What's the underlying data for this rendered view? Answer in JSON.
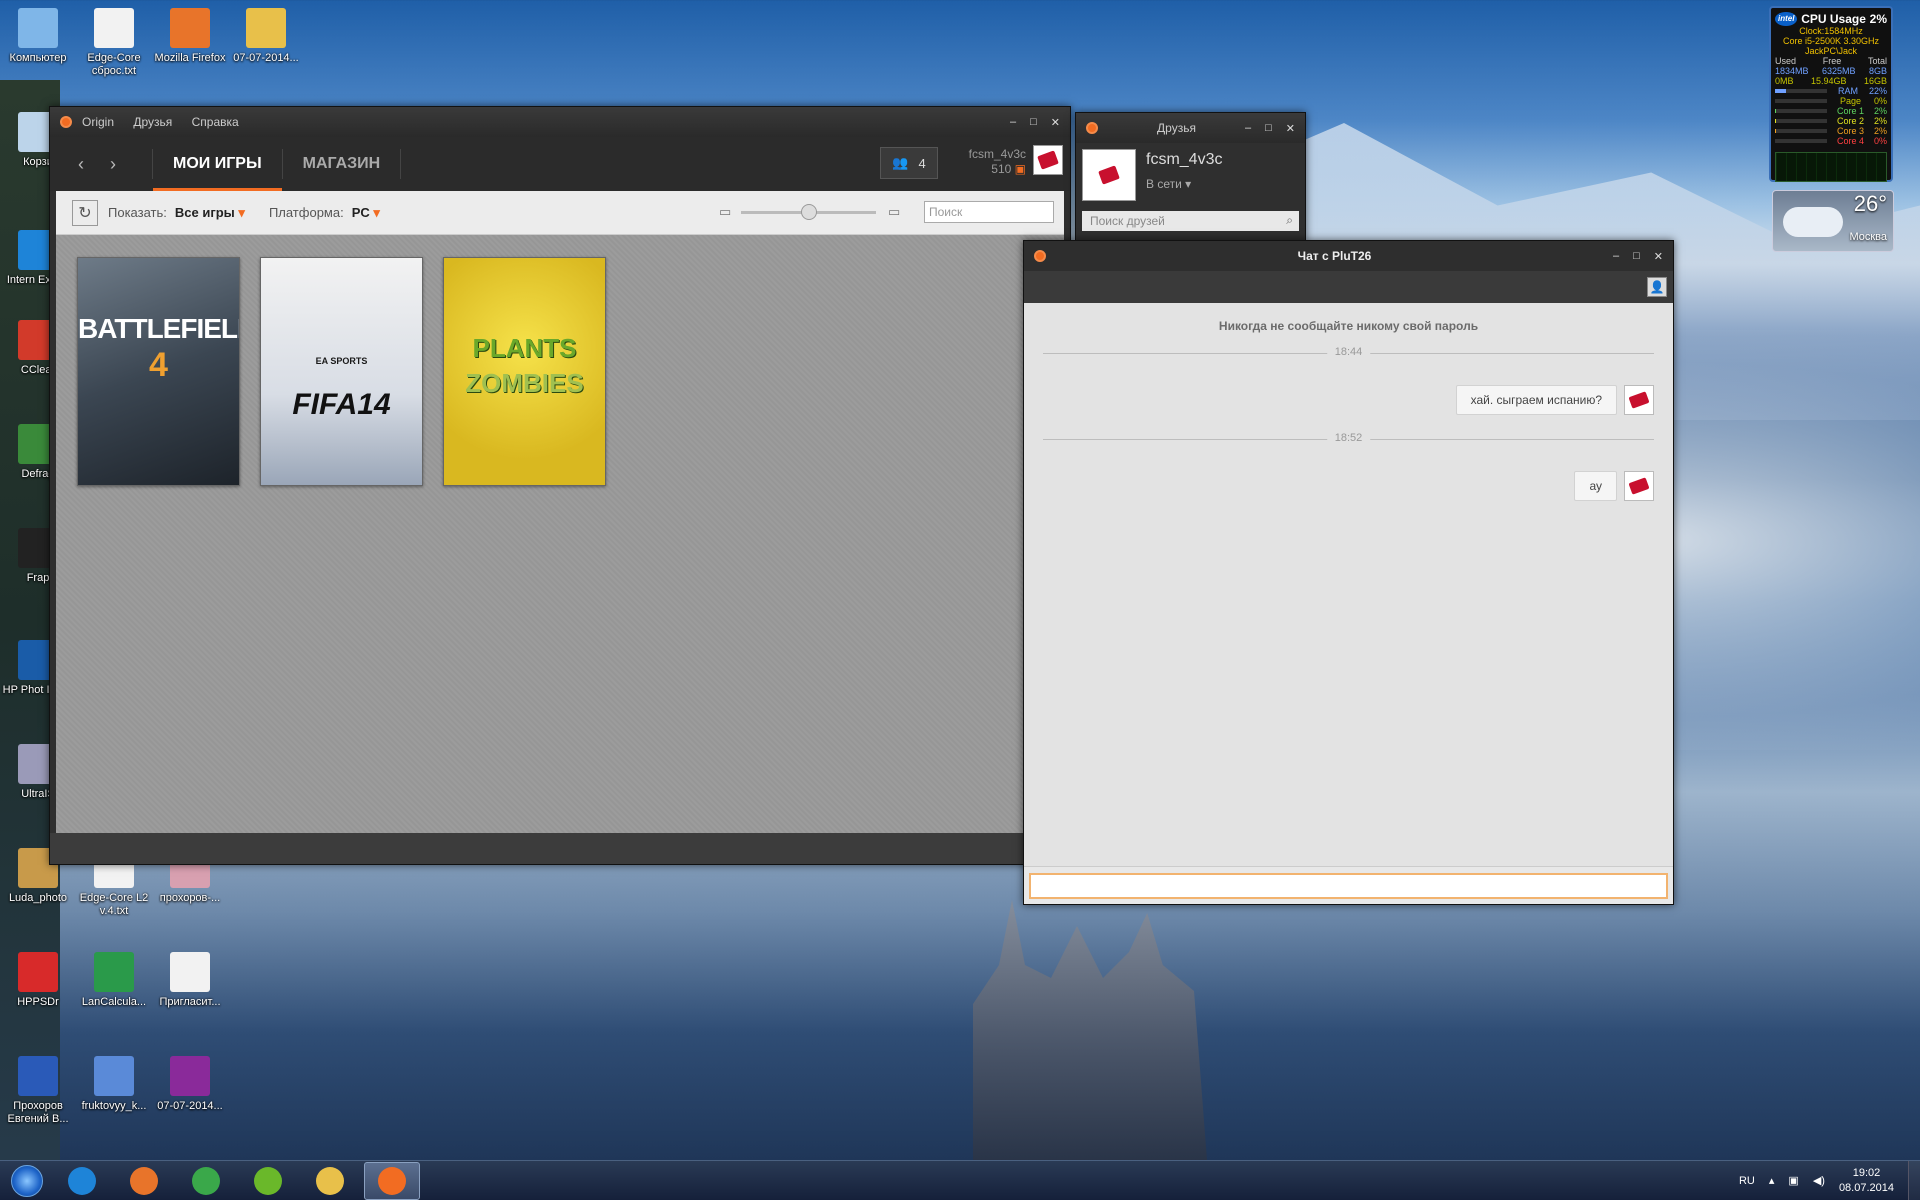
{
  "desktop": {
    "icons": [
      {
        "label": "Компьютер",
        "color": "#7fb6e8"
      },
      {
        "label": "Edge-Core сброс.txt",
        "color": "#f2f2f2"
      },
      {
        "label": "Mozilla Firefox",
        "color": "#e8742a"
      },
      {
        "label": "07-07-2014...",
        "color": "#e8c04a"
      },
      {
        "label": "Корзи",
        "color": "#bcd4ea"
      },
      {
        "label": "Intern Explor",
        "color": "#1e84d8"
      },
      {
        "label": "CClear",
        "color": "#d23a2a"
      },
      {
        "label": "Defrag",
        "color": "#3a8a3a"
      },
      {
        "label": "Frap",
        "color": "#222222"
      },
      {
        "label": "HP Phot Imagi",
        "color": "#1a5ca8"
      },
      {
        "label": "UltraIS",
        "color": "#9a9ab8"
      },
      {
        "label": "Luda_photo",
        "color": "#c89a4a"
      },
      {
        "label": "Edge-Core L2 v.4.txt",
        "color": "#f2f2f2"
      },
      {
        "label": "прохоров-...",
        "color": "#d8a0b0"
      },
      {
        "label": "HPPSDr",
        "color": "#d82a2a"
      },
      {
        "label": "LanCalcula...",
        "color": "#2a9a4a"
      },
      {
        "label": "Пригласит...",
        "color": "#f2f2f2"
      },
      {
        "label": "Прохоров Евгений В...",
        "color": "#2a5ab8"
      },
      {
        "label": "fruktovyy_k...",
        "color": "#5a8ad8"
      },
      {
        "label": "07-07-2014...",
        "color": "#8a2a9a"
      }
    ]
  },
  "origin": {
    "menu": [
      "Origin",
      "Друзья",
      "Справка"
    ],
    "tabs": {
      "my_games": "МОИ ИГРЫ",
      "store": "МАГАЗИН"
    },
    "friends_count": "4",
    "username": "fcsm_4v3c",
    "points": "510",
    "filter": {
      "show_label": "Показать:",
      "show_value": "Все игры",
      "platform_label": "Платформа:",
      "platform_value": "PC",
      "search_placeholder": "Поиск"
    },
    "games": [
      {
        "title": "BATTLEFIELD 4",
        "line1": "BATTLEFIELD",
        "line2": "4",
        "color": "#4a5562"
      },
      {
        "title": "FIFA 14",
        "line1": "EA SPORTS",
        "line2": "FIFA14",
        "color": "#dfe3ea"
      },
      {
        "title": "PLANTS vs. ZOMBIES",
        "line1": "PLANTS",
        "line2": "ZOMBIES",
        "color": "#e8d23a"
      }
    ]
  },
  "friends_window": {
    "title": "Друзья",
    "username": "fcsm_4v3c",
    "status": "В сети",
    "search_placeholder": "Поиск друзей"
  },
  "chat": {
    "title": "Чат с PluT26",
    "warning": "Никогда не сообщайте никому свой пароль",
    "messages": [
      {
        "time": "18:44",
        "text": "хай. сыграем испанию?"
      },
      {
        "time": "18:52",
        "text": "ау"
      }
    ]
  },
  "cpu_gadget": {
    "title": "CPU Usage",
    "usage": "2%",
    "brand": "intel",
    "clock": "Clock:1584MHz",
    "cpu": "Core i5-2500K 3.30GHz",
    "host": "JackPC\\Jack",
    "headers": [
      "Used",
      "Free",
      "Total"
    ],
    "row1": [
      "1834MB",
      "6325MB",
      "8GB"
    ],
    "row2": [
      "0MB",
      "15.94GB",
      "16GB"
    ],
    "meters": [
      {
        "name": "RAM",
        "value": "22%",
        "color": "#6fa0ff"
      },
      {
        "name": "Page",
        "value": "0%",
        "color": "#c4c400"
      },
      {
        "name": "Core 1",
        "value": "2%",
        "color": "#5fd35f"
      },
      {
        "name": "Core 2",
        "value": "2%",
        "color": "#e0e020"
      },
      {
        "name": "Core 3",
        "value": "2%",
        "color": "#f0a020"
      },
      {
        "name": "Core 4",
        "value": "0%",
        "color": "#ff4040"
      }
    ]
  },
  "weather": {
    "temp": "26°",
    "city": "Москва"
  },
  "taskbar": {
    "apps": [
      {
        "name": "internet-explorer",
        "color": "#1e84d8"
      },
      {
        "name": "firefox",
        "color": "#e8742a"
      },
      {
        "name": "chrome",
        "color": "#3aa84a"
      },
      {
        "name": "utorrent",
        "color": "#6ab82a"
      },
      {
        "name": "explorer",
        "color": "#e8c04a"
      },
      {
        "name": "origin",
        "color": "#f26c22"
      }
    ],
    "lang": "RU",
    "time": "19:02",
    "date": "08.07.2014"
  }
}
